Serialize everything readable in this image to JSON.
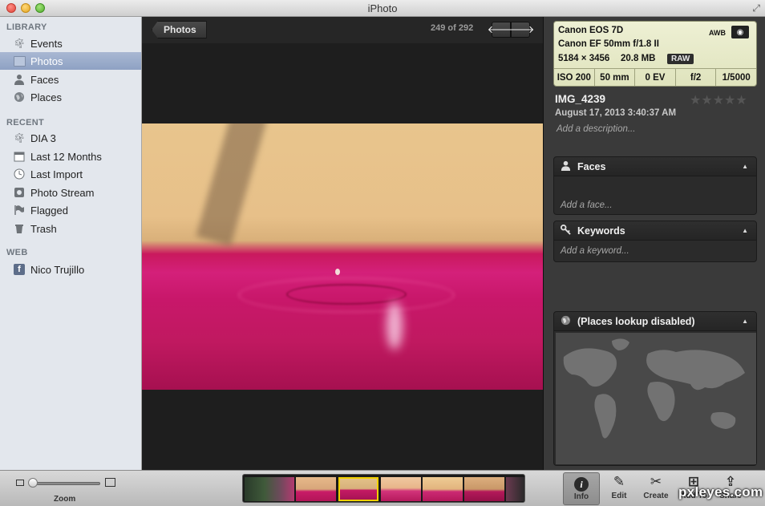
{
  "window": {
    "title": "iPhoto"
  },
  "sidebar": {
    "sections": [
      {
        "header": "LIBRARY",
        "items": [
          {
            "label": "Events",
            "icon": "palm-tree-icon"
          },
          {
            "label": "Photos",
            "icon": "photos-icon",
            "selected": true
          },
          {
            "label": "Faces",
            "icon": "person-icon"
          },
          {
            "label": "Places",
            "icon": "globe-icon"
          }
        ]
      },
      {
        "header": "RECENT",
        "items": [
          {
            "label": "DIA 3",
            "icon": "palm-tree-icon"
          },
          {
            "label": "Last 12 Months",
            "icon": "calendar-icon"
          },
          {
            "label": "Last Import",
            "icon": "clock-icon"
          },
          {
            "label": "Photo Stream",
            "icon": "photo-stream-icon"
          },
          {
            "label": "Flagged",
            "icon": "flag-icon"
          },
          {
            "label": "Trash",
            "icon": "trash-icon"
          }
        ]
      },
      {
        "header": "WEB",
        "items": [
          {
            "label": "Nico Trujillo",
            "icon": "facebook-icon"
          }
        ]
      }
    ]
  },
  "viewer": {
    "back_label": "Photos",
    "counter": "249 of 292"
  },
  "info": {
    "exif": {
      "camera": "Canon EOS 7D",
      "lens": "Canon EF 50mm f/1.8 II",
      "dimensions": "5184 × 3456",
      "filesize": "20.8 MB",
      "format": "RAW",
      "awb": "AWB",
      "iso": "ISO 200",
      "focal": "50 mm",
      "ev": "0 EV",
      "aperture": "f/2",
      "shutter": "1/5000"
    },
    "name": "IMG_4239",
    "date": "August 17, 2013 3:40:37 AM",
    "description_placeholder": "Add a description...",
    "rating": "★★★★★",
    "faces": {
      "title": "Faces",
      "placeholder": "Add a face..."
    },
    "keywords": {
      "title": "Keywords",
      "placeholder": "Add a keyword..."
    },
    "places": {
      "title": "(Places lookup disabled)"
    }
  },
  "bottombar": {
    "zoom_label": "Zoom",
    "zoom_level": 0.0,
    "tools": [
      {
        "label": "Info",
        "icon": "info-icon",
        "active": true
      },
      {
        "label": "Edit",
        "icon": "pencil-icon"
      },
      {
        "label": "Create",
        "icon": "create-icon"
      },
      {
        "label": "Add To",
        "icon": "add-icon"
      },
      {
        "label": "Share",
        "icon": "share-icon"
      }
    ]
  },
  "watermark": "pxleyes.com"
}
